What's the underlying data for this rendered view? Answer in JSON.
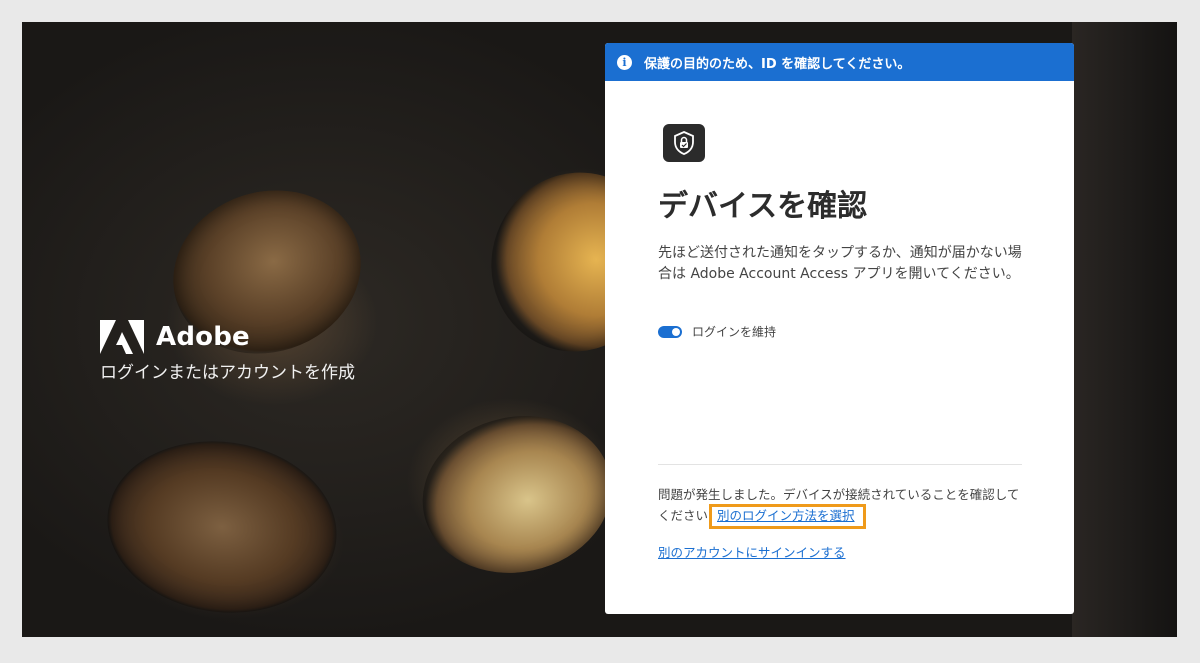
{
  "brand": {
    "name": "Adobe",
    "tagline": "ログインまたはアカウントを作成",
    "logo_icon": "adobe-logo-icon"
  },
  "card": {
    "banner_text": "保護の目的のため、ID を確認してください。",
    "banner_icon": "info-icon",
    "device_icon": "shield-lock-icon",
    "title": "デバイスを確認",
    "description": "先ほど送付された通知をタップするか、通知が届かない場合は Adobe Account Access アプリを開いてください。",
    "keep_signed_in_label": "ログインを維持",
    "keep_signed_in": true,
    "trouble_text": "問題が発生しました。デバイスが接続されていることを確認してください",
    "choose_other_method_link": "別のログイン方法を選択",
    "other_account_link": "別のアカウントにサインインする"
  },
  "colors": {
    "accent": "#1b6fd1",
    "highlight": "#ef9a1a",
    "page_background": "#e9e9e9"
  }
}
